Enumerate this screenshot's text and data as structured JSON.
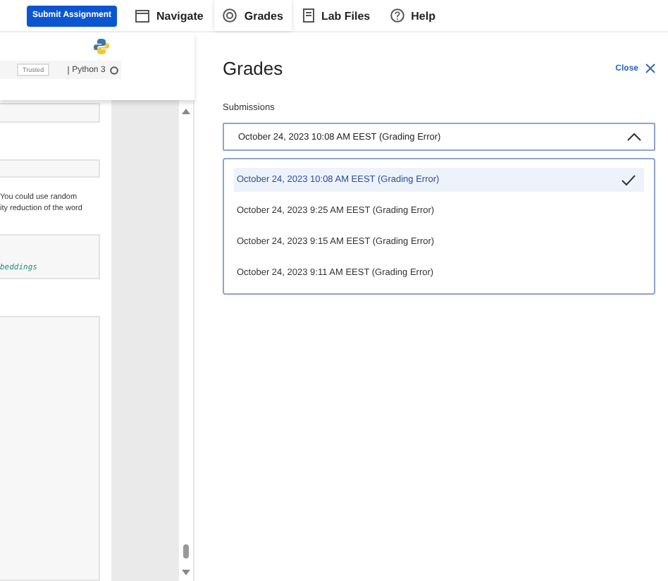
{
  "toolbar": {
    "submit_button": "Submit Assignment",
    "tabs": [
      {
        "label": "Navigate",
        "kind": "navigate",
        "selected": false
      },
      {
        "label": "Grades",
        "kind": "grades",
        "selected": true
      },
      {
        "label": "Lab Files",
        "kind": "files",
        "selected": false
      },
      {
        "label": "Help",
        "kind": "help",
        "selected": false
      }
    ]
  },
  "notebook": {
    "trusted": "Trusted",
    "kernel": "Python 3",
    "text_lines": [
      "You could use random",
      "ity reduction of the word"
    ],
    "code_text": "beddings"
  },
  "grades_panel": {
    "title": "Grades",
    "close": "Close",
    "submissions_label": "Submissions",
    "dropdown": {
      "value": "October 24, 2023 10:08 AM EEST (Grading Error)",
      "expanded": true
    },
    "options": [
      {
        "label": "October 24, 2023 10:08 AM EEST (Grading Error)",
        "selected": true
      },
      {
        "label": "October 24, 2023 9:25 AM EEST (Grading Error)",
        "selected": false
      },
      {
        "label": "October 24, 2023 9:15 AM EEST (Grading Error)",
        "selected": false
      },
      {
        "label": "October 24, 2023 9:11 AM EEST (Grading Error)",
        "selected": false
      }
    ]
  }
}
